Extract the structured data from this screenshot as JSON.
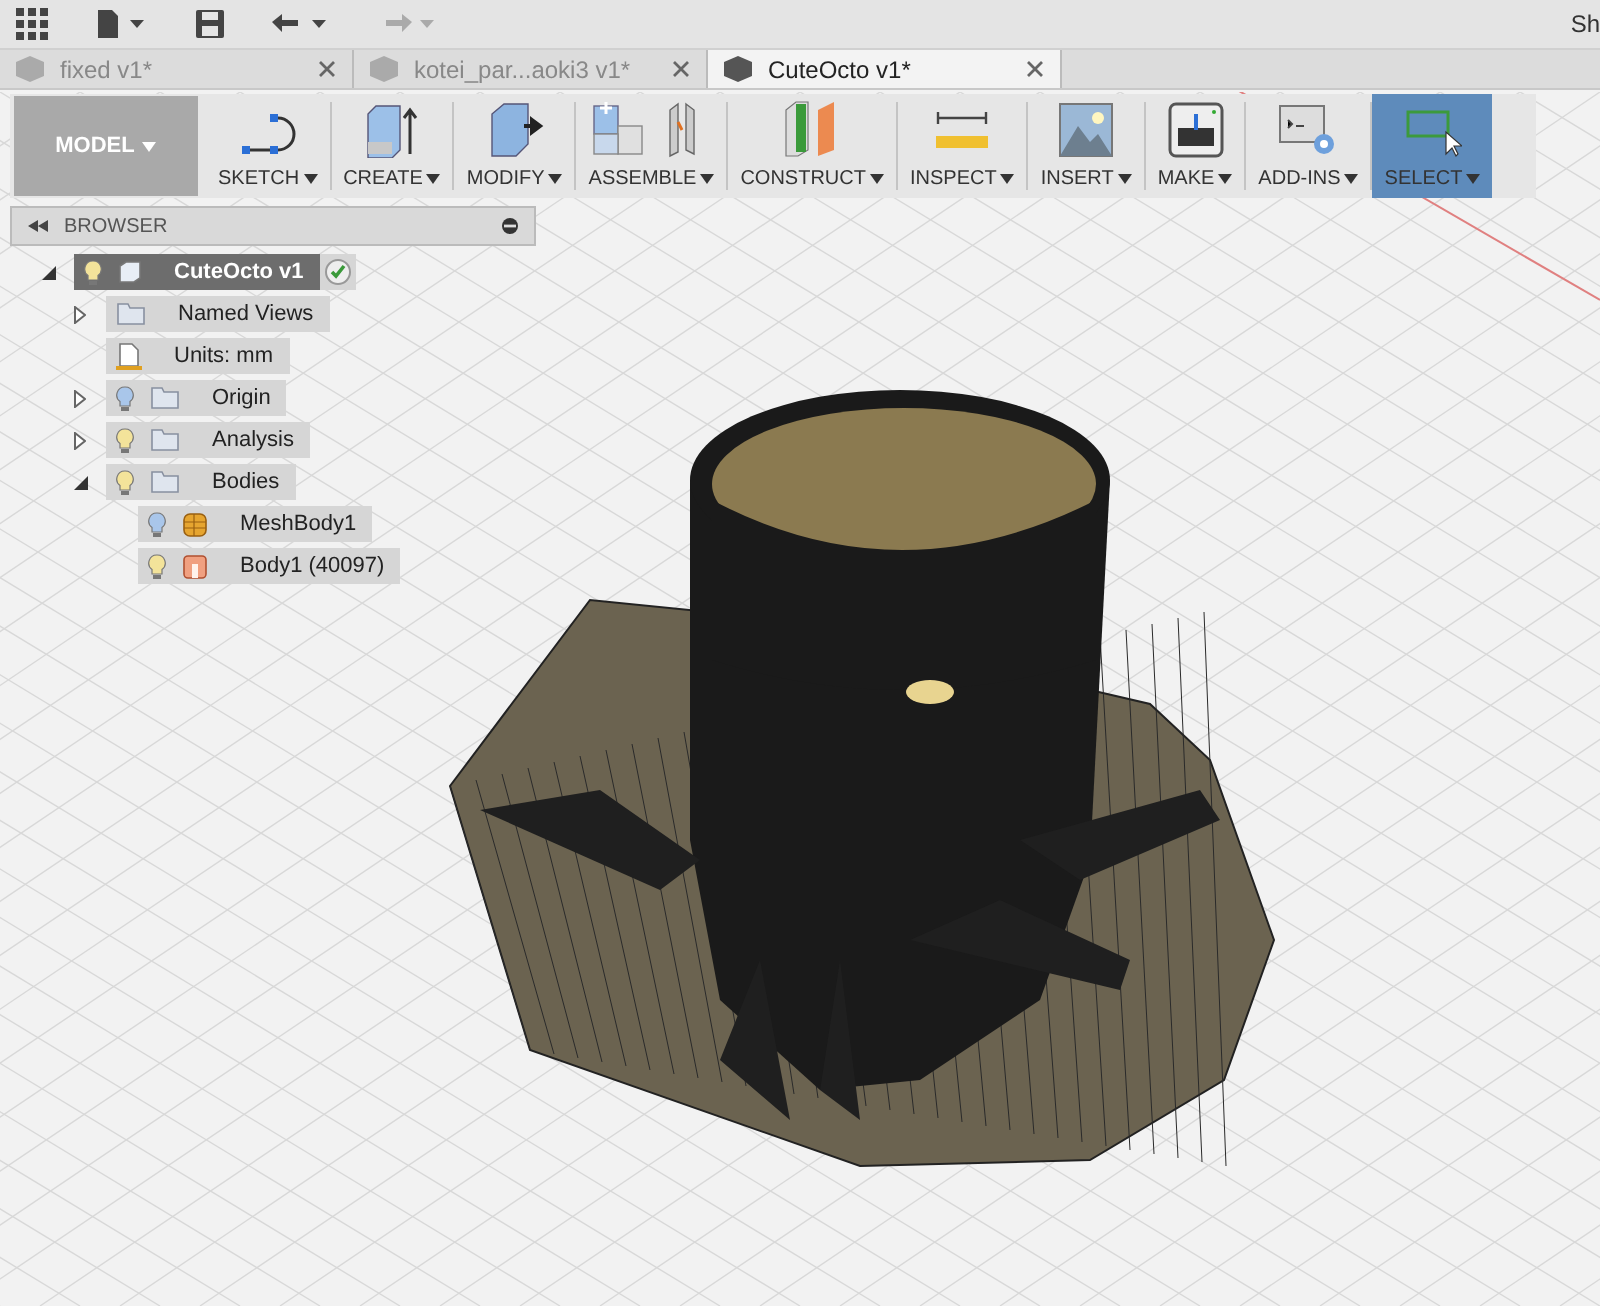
{
  "title_bar": {
    "user_text": "Sh"
  },
  "tabs": [
    {
      "label": "fixed v1*",
      "selected": false
    },
    {
      "label": "kotei_par...aoki3 v1*",
      "selected": false
    },
    {
      "label": "CuteOcto v1*",
      "selected": true
    }
  ],
  "workspace": {
    "label": "MODEL"
  },
  "toolbar": [
    {
      "kind": "sketch",
      "label": "SKETCH",
      "selected": false
    },
    {
      "kind": "create",
      "label": "CREATE",
      "selected": false
    },
    {
      "kind": "modify",
      "label": "MODIFY",
      "selected": false
    },
    {
      "kind": "assemble",
      "label": "ASSEMBLE",
      "selected": false
    },
    {
      "kind": "construct",
      "label": "CONSTRUCT",
      "selected": false
    },
    {
      "kind": "inspect",
      "label": "INSPECT",
      "selected": false
    },
    {
      "kind": "insert",
      "label": "INSERT",
      "selected": false
    },
    {
      "kind": "make",
      "label": "MAKE",
      "selected": false
    },
    {
      "kind": "addins",
      "label": "ADD-INS",
      "selected": false
    },
    {
      "kind": "select",
      "label": "SELECT",
      "selected": true
    }
  ],
  "browser": {
    "title": "BROWSER",
    "tree": [
      {
        "label": "CuteOcto v1",
        "kind": "component",
        "lit": true,
        "expanded": true,
        "selected": true,
        "children": [
          {
            "label": "Named Views",
            "kind": "folder",
            "expanded": false,
            "selected": false
          },
          {
            "label": "Units: mm",
            "kind": "units",
            "selected": false
          },
          {
            "label": "Origin",
            "kind": "folder",
            "lit": false,
            "expanded": false,
            "selected": false
          },
          {
            "label": "Analysis",
            "kind": "folder",
            "lit": true,
            "expanded": false,
            "selected": false
          },
          {
            "label": "Bodies",
            "kind": "folder",
            "lit": true,
            "expanded": true,
            "selected": false,
            "children": [
              {
                "label": "MeshBody1",
                "kind": "mesh",
                "lit": false,
                "selected": false
              },
              {
                "label": "Body1 (40097)",
                "kind": "body",
                "lit": true,
                "selected": false
              }
            ]
          }
        ]
      }
    ]
  }
}
